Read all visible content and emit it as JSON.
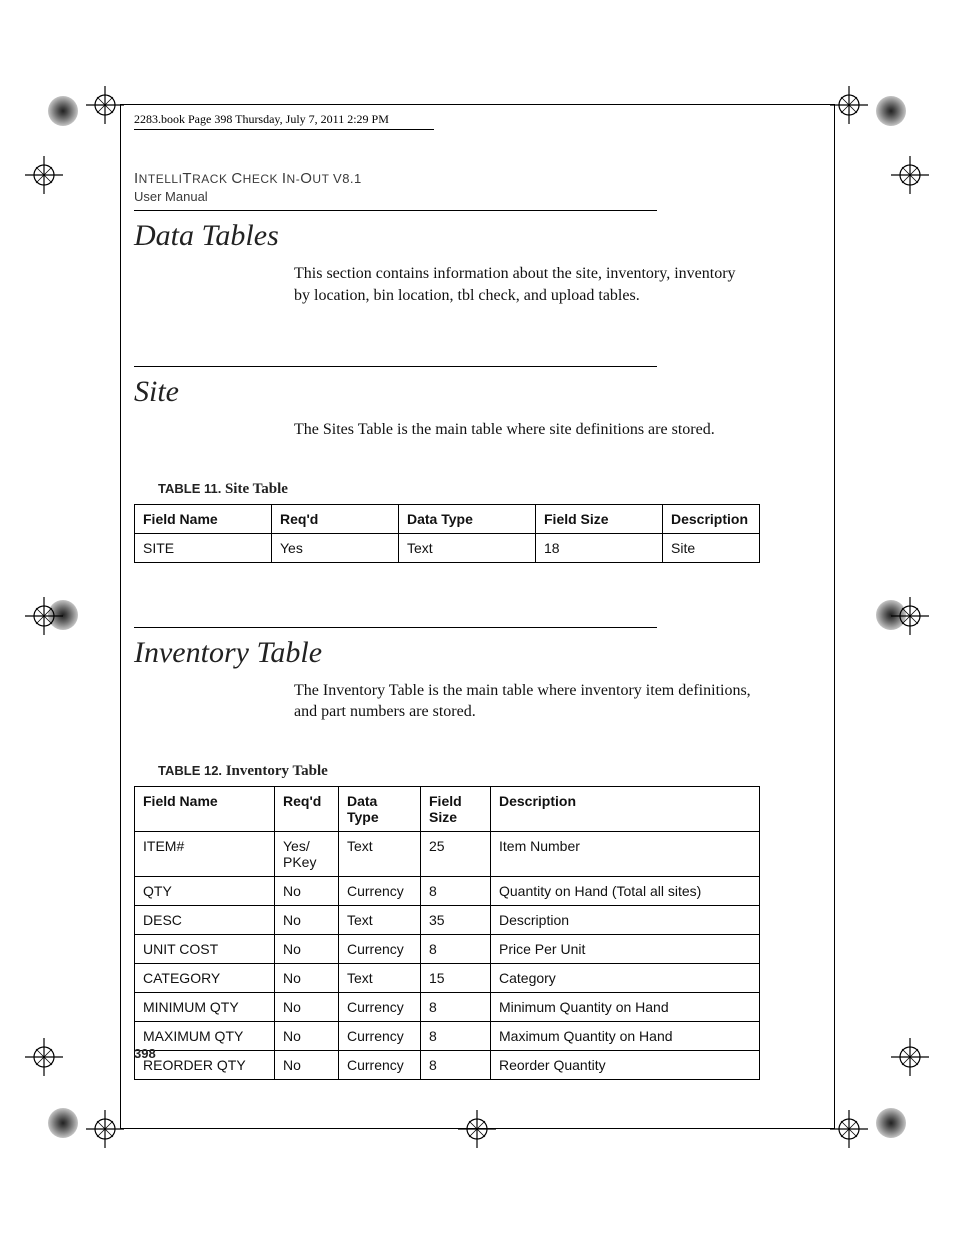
{
  "crop_header": "2283.book  Page 398  Thursday, July 7, 2011  2:29 PM",
  "running": {
    "title_smallcaps": "IntelliTrack Check In-Out ",
    "version": "V8.1",
    "subtitle": "User Manual"
  },
  "sections": {
    "data_tables": {
      "heading": "Data Tables",
      "body": "This section contains information about the site, inventory, inventory by location, bin location, tbl check, and upload tables."
    },
    "site": {
      "heading": "Site",
      "body": "The Sites Table is the main table where site definitions are stored."
    },
    "inventory": {
      "heading": "Inventory Table",
      "body": "The Inventory Table is the main table where inventory item definitions, and part numbers are stored."
    }
  },
  "table11": {
    "caption_num": "TABLE 11.",
    "caption_title": "Site Table",
    "headers": [
      "Field Name",
      "Req'd",
      "Data Type",
      "Field Size",
      "Description"
    ],
    "rows": [
      [
        "SITE",
        "Yes",
        "Text",
        "18",
        "Site"
      ]
    ]
  },
  "table12": {
    "caption_num": "TABLE 12.",
    "caption_title": "Inventory Table",
    "headers": [
      "Field Name",
      "Req'd",
      "Data Type",
      "Field Size",
      "Description"
    ],
    "header_stacked": {
      "2": "Data\nType",
      "3": "Field\nSize"
    },
    "rows": [
      [
        "ITEM#",
        "Yes/ PKey",
        "Text",
        "25",
        "Item Number"
      ],
      [
        "QTY",
        "No",
        "Currency",
        "8",
        "Quantity on Hand (Total all sites)"
      ],
      [
        "DESC",
        "No",
        "Text",
        "35",
        "Description"
      ],
      [
        "UNIT COST",
        "No",
        "Currency",
        "8",
        "Price Per Unit"
      ],
      [
        "CATEGORY",
        "No",
        "Text",
        "15",
        "Category"
      ],
      [
        "MINIMUM QTY",
        "No",
        "Currency",
        "8",
        "Minimum Quantity on Hand"
      ],
      [
        "MAXIMUM QTY",
        "No",
        "Currency",
        "8",
        "Maximum Quantity on Hand"
      ],
      [
        "REORDER QTY",
        "No",
        "Currency",
        "8",
        "Reorder Quantity"
      ]
    ]
  },
  "page_number": "398",
  "chart_data": [
    {
      "type": "table",
      "title": "TABLE 11. Site Table",
      "columns": [
        "Field Name",
        "Req'd",
        "Data Type",
        "Field Size",
        "Description"
      ],
      "rows": [
        [
          "SITE",
          "Yes",
          "Text",
          "18",
          "Site"
        ]
      ]
    },
    {
      "type": "table",
      "title": "TABLE 12. Inventory Table",
      "columns": [
        "Field Name",
        "Req'd",
        "Data Type",
        "Field Size",
        "Description"
      ],
      "rows": [
        [
          "ITEM#",
          "Yes/ PKey",
          "Text",
          "25",
          "Item Number"
        ],
        [
          "QTY",
          "No",
          "Currency",
          "8",
          "Quantity on Hand (Total all sites)"
        ],
        [
          "DESC",
          "No",
          "Text",
          "35",
          "Description"
        ],
        [
          "UNIT COST",
          "No",
          "Currency",
          "8",
          "Price Per Unit"
        ],
        [
          "CATEGORY",
          "No",
          "Text",
          "15",
          "Category"
        ],
        [
          "MINIMUM QTY",
          "No",
          "Currency",
          "8",
          "Minimum Quantity on Hand"
        ],
        [
          "MAXIMUM QTY",
          "No",
          "Currency",
          "8",
          "Maximum Quantity on Hand"
        ],
        [
          "REORDER QTY",
          "No",
          "Currency",
          "8",
          "Reorder Quantity"
        ]
      ]
    }
  ]
}
